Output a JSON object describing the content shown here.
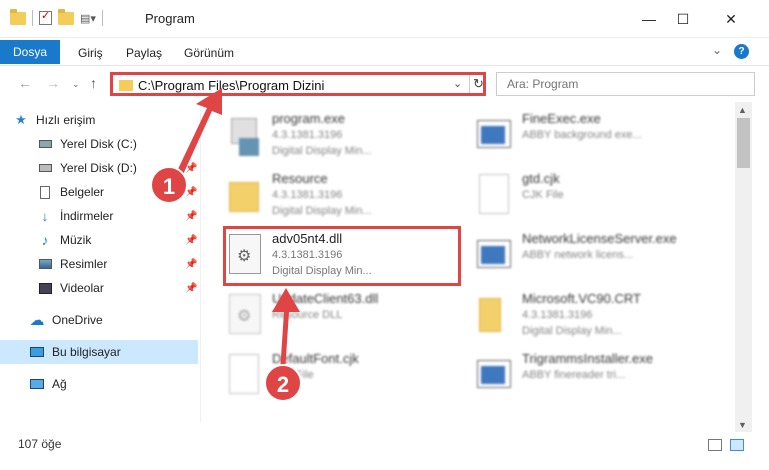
{
  "window": {
    "title": "Program",
    "minimize": "—",
    "maximize": "☐",
    "close": "✕"
  },
  "menu": {
    "file": "Dosya",
    "items": [
      "Giriş",
      "Paylaş",
      "Görünüm"
    ]
  },
  "address": {
    "path": "C:\\Program Files\\Program Dizini"
  },
  "search": {
    "placeholder": "Ara: Program"
  },
  "sidebar": {
    "items": [
      {
        "label": "Hızlı erişim",
        "icon": "star-icon"
      },
      {
        "label": "Yerel Disk (C:)",
        "icon": "drive-icon"
      },
      {
        "label": "Yerel Disk (D:)",
        "icon": "drive-icon"
      },
      {
        "label": "Belgeler",
        "icon": "documents-icon"
      },
      {
        "label": "İndirmeler",
        "icon": "download-icon"
      },
      {
        "label": "Müzik",
        "icon": "music-icon"
      },
      {
        "label": "Resimler",
        "icon": "pictures-icon"
      },
      {
        "label": "Videolar",
        "icon": "videos-icon"
      },
      {
        "label": "OneDrive",
        "icon": "cloud-icon"
      },
      {
        "label": "Bu bilgisayar",
        "icon": "computer-icon"
      },
      {
        "label": "Ağ",
        "icon": "network-icon"
      }
    ]
  },
  "files": [
    {
      "name": "program.exe",
      "line1": "4.3.1381.3196",
      "line2": "Digital Display Min..."
    },
    {
      "name": "Resource",
      "line1": "4.3.1381.3196",
      "line2": "Digital Display Min..."
    },
    {
      "name": "adv05nt4.dll",
      "line1": "4.3.1381.3196",
      "line2": "Digital Display Min..."
    },
    {
      "name": "UpdateClient63.dll",
      "line1": "Resource DLL",
      "line2": ""
    },
    {
      "name": "DefaultFont.cjk",
      "line1": "CJK File",
      "line2": ""
    },
    {
      "name": "FineExec.exe",
      "line1": "ABBY background exe...",
      "line2": ""
    },
    {
      "name": "gtd.cjk",
      "line1": "CJK File",
      "line2": ""
    },
    {
      "name": "NetworkLicenseServer.exe",
      "line1": "ABBY network licens...",
      "line2": ""
    },
    {
      "name": "Microsoft.VC90.CRT",
      "line1": "4.3.1381.3196",
      "line2": "Digital Display Min..."
    },
    {
      "name": "TrigrammsInstaller.exe",
      "line1": "ABBY finereader tri...",
      "line2": ""
    }
  ],
  "status": {
    "count": "107 öğe"
  },
  "callouts": [
    "1",
    "2"
  ],
  "colors": {
    "accent": "#1979ca",
    "callout": "#e04545"
  }
}
